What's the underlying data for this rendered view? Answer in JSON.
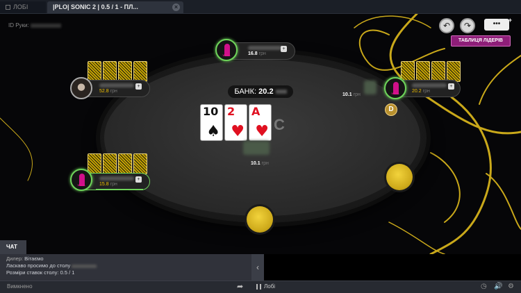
{
  "tabs": {
    "lobby": "ЛОБІ",
    "active": "|PLO| SONIC 2 | 0.5",
    "active_suffix": "/ 1",
    "active_tail": "- ПЛ..."
  },
  "hand_id_label": "ID Руки:",
  "leaderboard_label": "ТАБЛИЦЯ ЛІДЕРІВ",
  "pot": {
    "label": "БАНК:",
    "amount": "20.2"
  },
  "board": [
    {
      "rank": "10",
      "suit": "♠",
      "color": "black"
    },
    {
      "rank": "2",
      "suit": "♥",
      "color": "red"
    },
    {
      "rank": "A",
      "suit": "♥",
      "color": "red"
    }
  ],
  "seats": {
    "top": {
      "stack": "16.8",
      "avatar_text": "VEGA"
    },
    "left": {
      "stack": "52.8"
    },
    "right": {
      "stack": "20.2",
      "avatar_text": "VEGA"
    },
    "hero": {
      "stack": "15.8",
      "avatar_text": "VEGA"
    }
  },
  "bets": {
    "right": {
      "amount": "10.1",
      "unit": "грн"
    },
    "center": {
      "amount": "10.1",
      "unit": "грн"
    }
  },
  "stack_unit": "грн",
  "dealer_button": "D",
  "chat": {
    "tab": "ЧАТ",
    "lines": [
      {
        "who": "Дилер:",
        "text": " Вітаємо"
      },
      {
        "who": "",
        "text": "Ласкаво просимо до столу"
      },
      {
        "who": "",
        "text": "Розміри ставок столу: 0.5 / 1"
      }
    ],
    "collapse_icon": "‹"
  },
  "bottom": {
    "chat_status": "Вимкнено",
    "lobby_link": "Лобі"
  },
  "icons": {
    "undo": "↶",
    "redo": "↷",
    "menu": "•••",
    "send": "➦",
    "history": "◷",
    "sound": "🔊",
    "settings": "⚙",
    "close": "×"
  },
  "colors": {
    "accent": "#8e1e78",
    "gold": "#f2c200",
    "highlight": "#6ed35a"
  }
}
